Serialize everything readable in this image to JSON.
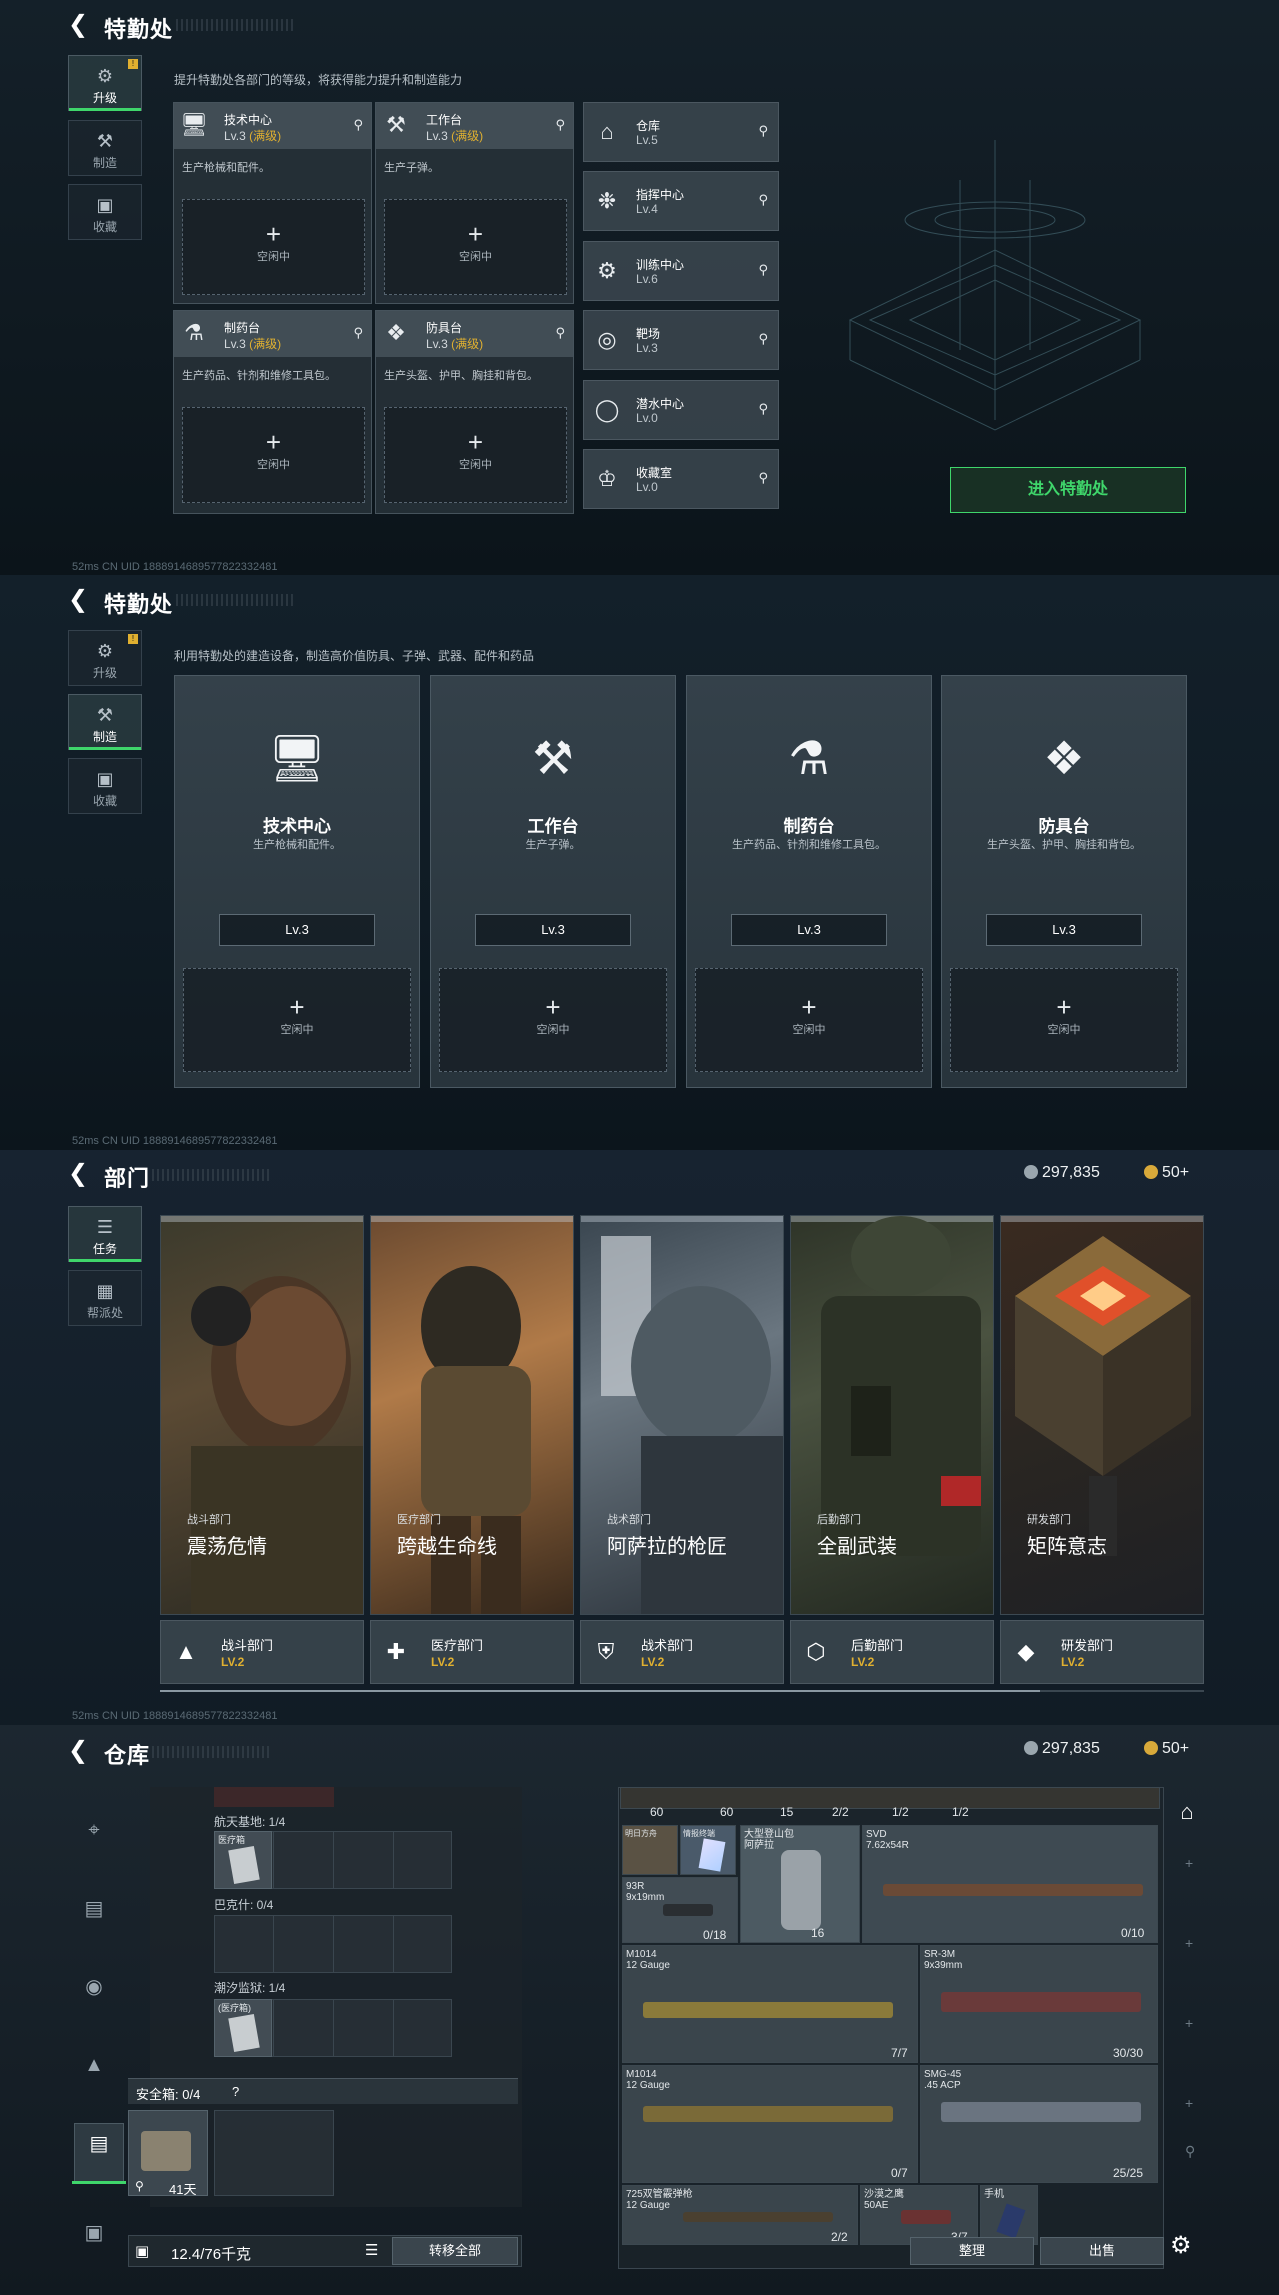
{
  "p1": {
    "title": "特勤处",
    "desc": "提升特勤处各部门的等级，将获得能力提升和制造能力",
    "tabs": [
      {
        "label": "升级",
        "badge": "!"
      },
      {
        "label": "制造"
      },
      {
        "label": "收藏"
      }
    ],
    "devices": [
      {
        "name": "技术中心",
        "level": "Lv.3",
        "max": "(满级)",
        "sub": "生产枪械和配件。",
        "slot": "空闲中"
      },
      {
        "name": "工作台",
        "level": "Lv.3",
        "max": "(满级)",
        "sub": "生产子弹。",
        "slot": "空闲中"
      },
      {
        "name": "制药台",
        "level": "Lv.3",
        "max": "(满级)",
        "sub": "生产药品、针剂和维修工具包。",
        "slot": "空闲中"
      },
      {
        "name": "防具台",
        "level": "Lv.3",
        "max": "(满级)",
        "sub": "生产头盔、护甲、胸挂和背包。",
        "slot": "空闲中"
      }
    ],
    "facilities": [
      {
        "name": "仓库",
        "level": "Lv.5"
      },
      {
        "name": "指挥中心",
        "level": "Lv.4"
      },
      {
        "name": "训练中心",
        "level": "Lv.6"
      },
      {
        "name": "靶场",
        "level": "Lv.3"
      },
      {
        "name": "潜水中心",
        "level": "Lv.0"
      },
      {
        "name": "收藏室",
        "level": "Lv.0"
      }
    ],
    "enter_button": "进入特勤处",
    "status": "52ms   CN UID 1888914689577822332481"
  },
  "p2": {
    "title": "特勤处",
    "desc": "利用特勤处的建造设备，制造高价值防具、子弹、武器、配件和药品",
    "tabs": [
      {
        "label": "升级",
        "badge": "!"
      },
      {
        "label": "制造"
      },
      {
        "label": "收藏"
      }
    ],
    "cards": [
      {
        "name": "技术中心",
        "sub": "生产枪械和配件。",
        "level": "Lv.3",
        "slot": "空闲中"
      },
      {
        "name": "工作台",
        "sub": "生产子弹。",
        "level": "Lv.3",
        "slot": "空闲中"
      },
      {
        "name": "制药台",
        "sub": "生产药品、针剂和维修工具包。",
        "level": "Lv.3",
        "slot": "空闲中"
      },
      {
        "name": "防具台",
        "sub": "生产头盔、护甲、胸挂和背包。",
        "level": "Lv.3",
        "slot": "空闲中"
      }
    ],
    "status": "52ms   CN UID 1888914689577822332481"
  },
  "p3": {
    "title": "部门",
    "currency1": "297,835",
    "currency2": "50+",
    "tabs": [
      {
        "label": "任务"
      },
      {
        "label": "帮派处"
      }
    ],
    "departments": [
      {
        "tag": "战斗部门",
        "title": "震荡危情",
        "name": "战斗部门",
        "level": "LV.2"
      },
      {
        "tag": "医疗部门",
        "title": "跨越生命线",
        "name": "医疗部门",
        "level": "LV.2"
      },
      {
        "tag": "战术部门",
        "title": "阿萨拉的枪匠",
        "name": "战术部门",
        "level": "LV.2"
      },
      {
        "tag": "后勤部门",
        "title": "全副武装",
        "name": "后勤部门",
        "level": "LV.2"
      },
      {
        "tag": "研发部门",
        "title": "矩阵意志",
        "name": "研发部门",
        "level": "LV.2"
      }
    ],
    "status": "52ms   CN UID 1888914689577822332481"
  },
  "p4": {
    "title": "仓库",
    "currency1": "297,835",
    "currency2": "50+",
    "sections": [
      {
        "label": "航天基地: 1/4",
        "item": "医疗箱"
      },
      {
        "label": "巴克什: 0/4"
      },
      {
        "label": "潮汐监狱: 1/4",
        "item": "(医疗箱)"
      }
    ],
    "safebox": {
      "label": "安全箱: 0/4",
      "help": "?",
      "time": "41天"
    },
    "capacity": "12.4/76千克",
    "transfer_all": "转移全部",
    "top_counts": [
      "60",
      "60",
      "15",
      "2/2",
      "1/2",
      "1/2"
    ],
    "items": [
      {
        "name": "明日方舟",
        "count": ""
      },
      {
        "name": "情报终端",
        "count": ""
      },
      {
        "name": "大型登山包\n阿萨拉",
        "count": "16"
      },
      {
        "name": "SVD\n7.62x54R",
        "count": "0/10"
      },
      {
        "name": "93R\n9x19mm",
        "count": "0/18"
      },
      {
        "name": "M1014\n12 Gauge",
        "count": "7/7"
      },
      {
        "name": "SR-3M\n9x39mm",
        "count": "30/30"
      },
      {
        "name": "M1014\n12 Gauge",
        "count": "0/7"
      },
      {
        "name": "SMG-45\n.45 ACP",
        "count": "25/25"
      },
      {
        "name": "725双管霰弹枪\n12 Gauge",
        "count": "2/2"
      },
      {
        "name": "沙漠之鹰\n50AE",
        "count": "3/7"
      },
      {
        "name": "手机",
        "count": ""
      }
    ],
    "sort_button": "整理",
    "sell_button": "出售"
  }
}
